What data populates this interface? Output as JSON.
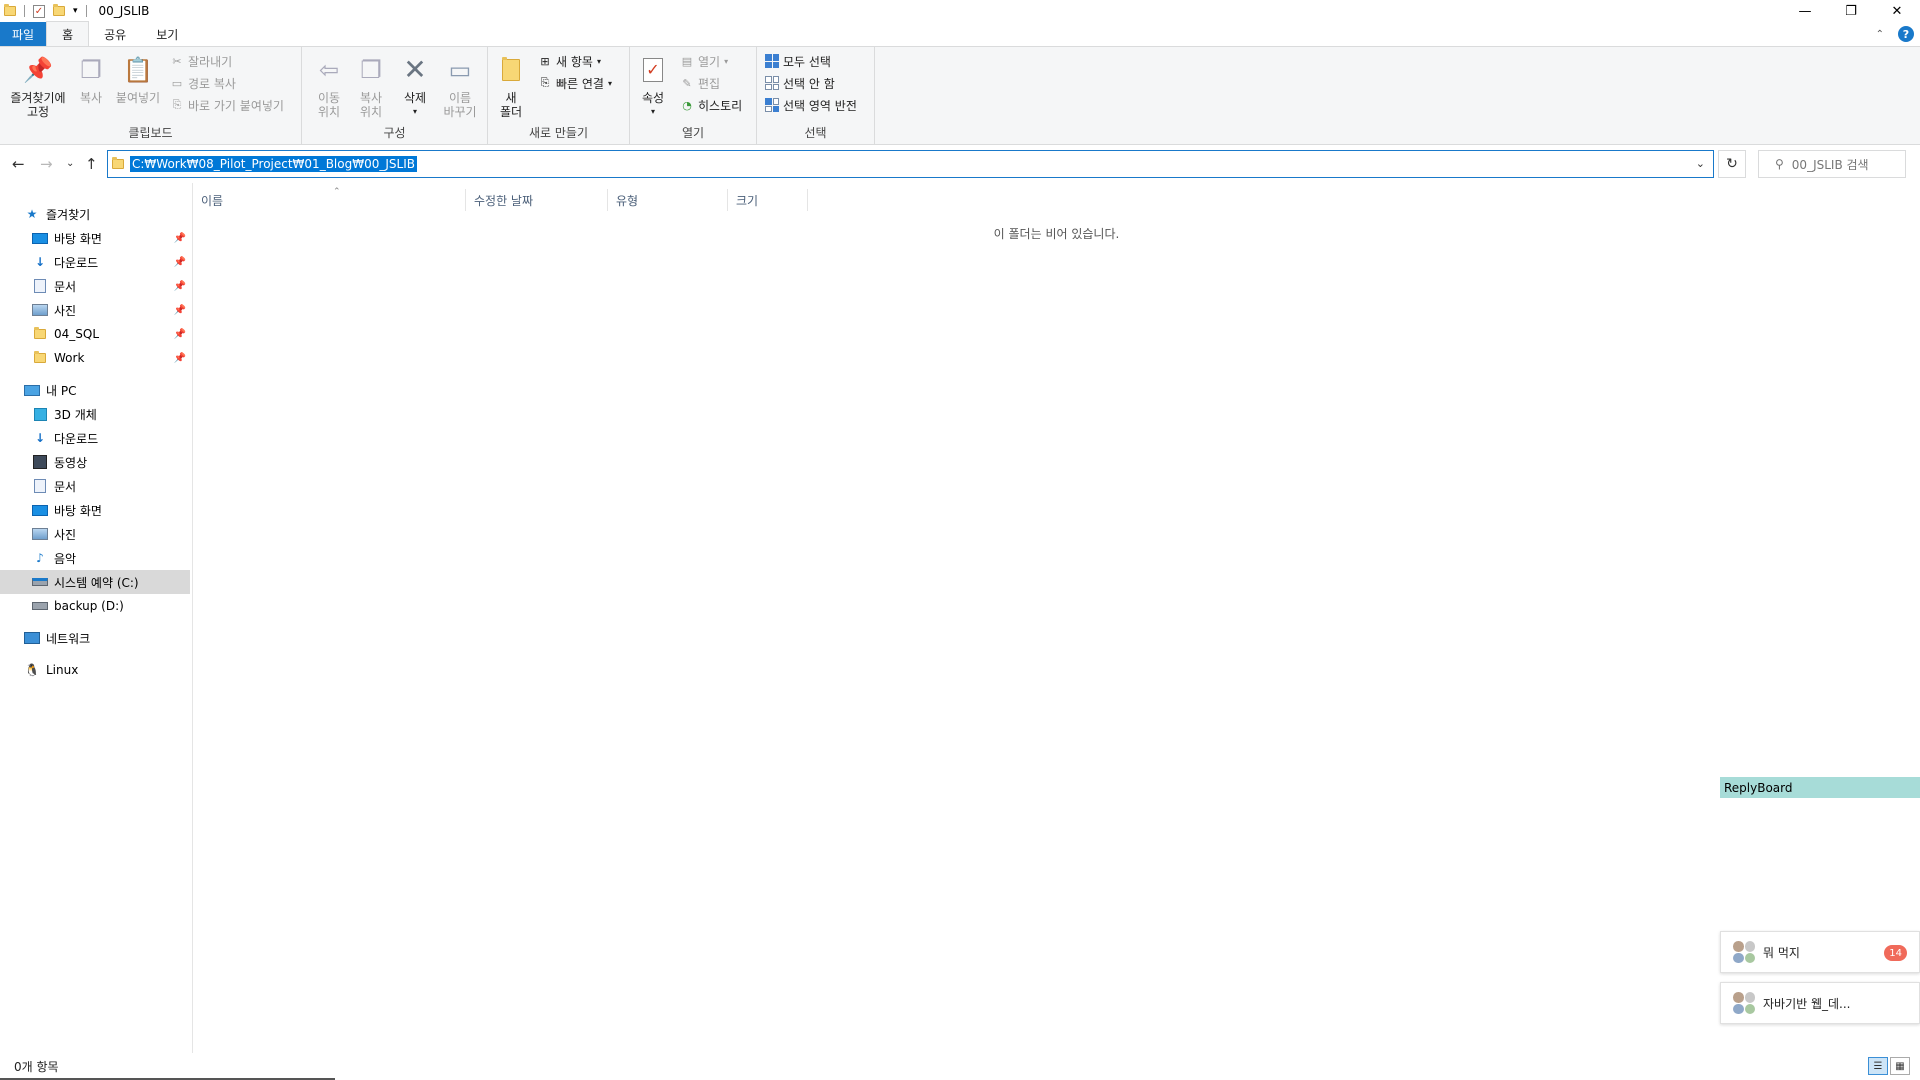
{
  "window": {
    "title": "00_JSLIB",
    "minimize": "—",
    "restore": "❐",
    "close": "✕"
  },
  "ribbon_tabs": {
    "file": "파일",
    "home": "홈",
    "share": "공유",
    "view": "보기"
  },
  "ribbon": {
    "clipboard": {
      "label": "클립보드",
      "pin_quick_access": [
        "즐겨찾기에",
        "고정"
      ],
      "copy": "복사",
      "paste": "붙여넣기",
      "cut": "잘라내기",
      "copy_path": "경로 복사",
      "paste_shortcut": "바로 가기 붙여넣기"
    },
    "organize": {
      "label": "구성",
      "move_to": [
        "이동",
        "위치"
      ],
      "copy_to": [
        "복사",
        "위치"
      ],
      "delete": "삭제",
      "rename": [
        "이름",
        "바꾸기"
      ]
    },
    "new": {
      "label": "새로 만들기",
      "new_folder": [
        "새",
        "폴더"
      ],
      "new_item": "새 항목",
      "easy_access": "빠른 연결"
    },
    "open": {
      "label": "열기",
      "properties": "속성",
      "open": "열기",
      "edit": "편집",
      "history": "히스토리"
    },
    "select": {
      "label": "선택",
      "select_all": "모두 선택",
      "select_none": "선택 안 함",
      "invert_selection": "선택 영역 반전"
    }
  },
  "address": {
    "path": "C:₩Work₩08_Pilot_Project₩01_Blog₩00_JSLIB",
    "search_placeholder": "00_JSLIB 검색"
  },
  "nav": {
    "quick_access": "즐겨찾기",
    "quick_items": [
      "바탕 화면",
      "다운로드",
      "문서",
      "사진",
      "04_SQL",
      "Work"
    ],
    "this_pc": "내 PC",
    "pc_items": [
      "3D 개체",
      "다운로드",
      "동영상",
      "문서",
      "바탕 화면",
      "사진",
      "음악",
      "시스템 예약 (C:)",
      "backup (D:)"
    ],
    "network": "네트워크",
    "linux": "Linux"
  },
  "columns": {
    "name": "이름",
    "date_modified": "수정한 날짜",
    "type": "유형",
    "size": "크기"
  },
  "empty_message": "이 폴더는 비어 있습니다.",
  "status": {
    "item_count": "0개 항목"
  },
  "overlay": {
    "replyboard": "ReplyBoard",
    "chats": [
      {
        "name": "뭐 먹지",
        "unread": "14"
      },
      {
        "name": "자바기반 웹_데..."
      }
    ]
  },
  "colors": {
    "accent": "#1979ca",
    "selection": "#0078d7",
    "replyboard_bg": "#a7dcd8",
    "badge": "#f06a5a"
  }
}
